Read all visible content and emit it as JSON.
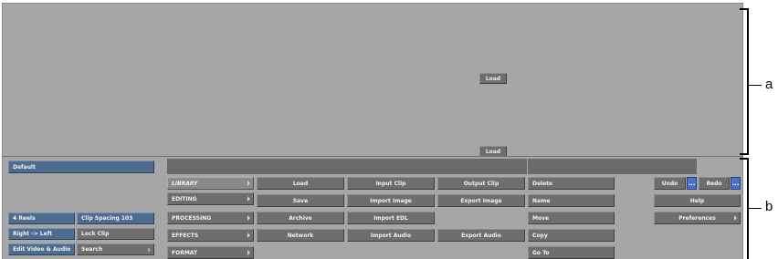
{
  "viewer": {
    "load_top": "Load",
    "load_bottom": "Load"
  },
  "setup": {
    "name": "Default"
  },
  "left_panel": {
    "reels": "4 Reels",
    "clip_spacing": "Clip Spacing 103",
    "direction": "Right -> Left",
    "lock_clip": "Lock Clip",
    "edit_mode": "Edit Video & Audio",
    "search": "Search"
  },
  "menu": {
    "items": [
      {
        "label": "LIBRARY"
      },
      {
        "label": "EDITING"
      },
      {
        "label": "PROCESSING"
      },
      {
        "label": "EFFECTS"
      },
      {
        "label": "FORMAT"
      }
    ]
  },
  "library": {
    "load": "Load",
    "input_clip": "Input Clip",
    "output_clip": "Output Clip",
    "save": "Save",
    "import_image": "Import Image",
    "export_image": "Export Image",
    "archive": "Archive",
    "import_edl": "Import EDL",
    "network": "Network",
    "import_audio": "Import Audio",
    "export_audio": "Export Audio"
  },
  "clip_ops": {
    "delete": "Delete",
    "name": "Name",
    "move": "Move",
    "copy": "Copy",
    "go_to": "Go To"
  },
  "global": {
    "undo": "Undo",
    "redo": "Redo",
    "dots": "...",
    "help": "Help",
    "preferences": "Preferences"
  },
  "callouts": {
    "a": "a",
    "b": "b"
  }
}
